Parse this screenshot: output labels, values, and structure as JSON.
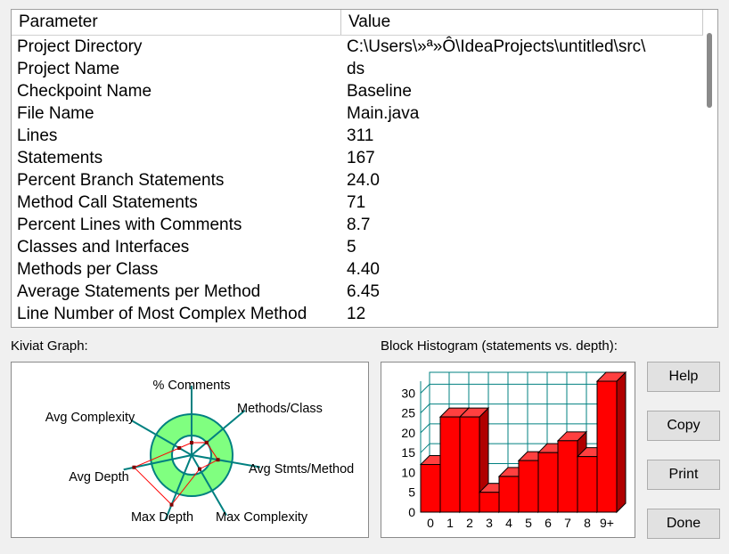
{
  "table": {
    "headers": [
      "Parameter",
      "Value"
    ],
    "rows": [
      {
        "param": "Project Directory",
        "value": "C:\\Users\\»ª»Ô\\IdeaProjects\\untitled\\src\\"
      },
      {
        "param": "Project Name",
        "value": "ds"
      },
      {
        "param": "Checkpoint Name",
        "value": "Baseline"
      },
      {
        "param": "File Name",
        "value": "Main.java"
      },
      {
        "param": "Lines",
        "value": "311"
      },
      {
        "param": "Statements",
        "value": "167"
      },
      {
        "param": "Percent Branch Statements",
        "value": "24.0"
      },
      {
        "param": "Method Call Statements",
        "value": "71"
      },
      {
        "param": "Percent Lines with Comments",
        "value": "8.7"
      },
      {
        "param": "Classes and Interfaces",
        "value": "5"
      },
      {
        "param": "Methods per Class",
        "value": "4.40"
      },
      {
        "param": "Average Statements per Method",
        "value": "6.45"
      },
      {
        "param": "Line Number of Most Complex Method",
        "value": "12"
      }
    ]
  },
  "kiviat": {
    "title": "Kiviat Graph:",
    "axes": [
      "% Comments",
      "Methods/Class",
      "Avg Stmts/Method",
      "Max Complexity",
      "Max Depth",
      "Avg Depth",
      "Avg Complexity"
    ],
    "normal_range_color": "#80ff80",
    "axis_color": "#008080",
    "value_color": "#ff0000"
  },
  "histogram": {
    "title": "Block Histogram (statements vs. depth):",
    "bar_color": "#ff0000",
    "grid_color": "#008080"
  },
  "chart_data": {
    "type": "bar",
    "categories": [
      "0",
      "1",
      "2",
      "3",
      "4",
      "5",
      "6",
      "7",
      "8",
      "9+"
    ],
    "values": [
      12,
      24,
      24,
      5,
      9,
      13,
      15,
      18,
      14,
      33
    ],
    "yticks": [
      "0",
      "5",
      "10",
      "15",
      "20",
      "25",
      "30"
    ],
    "ylim": [
      0,
      33
    ]
  },
  "buttons": {
    "help": "Help",
    "copy": "Copy",
    "print": "Print",
    "done": "Done"
  }
}
